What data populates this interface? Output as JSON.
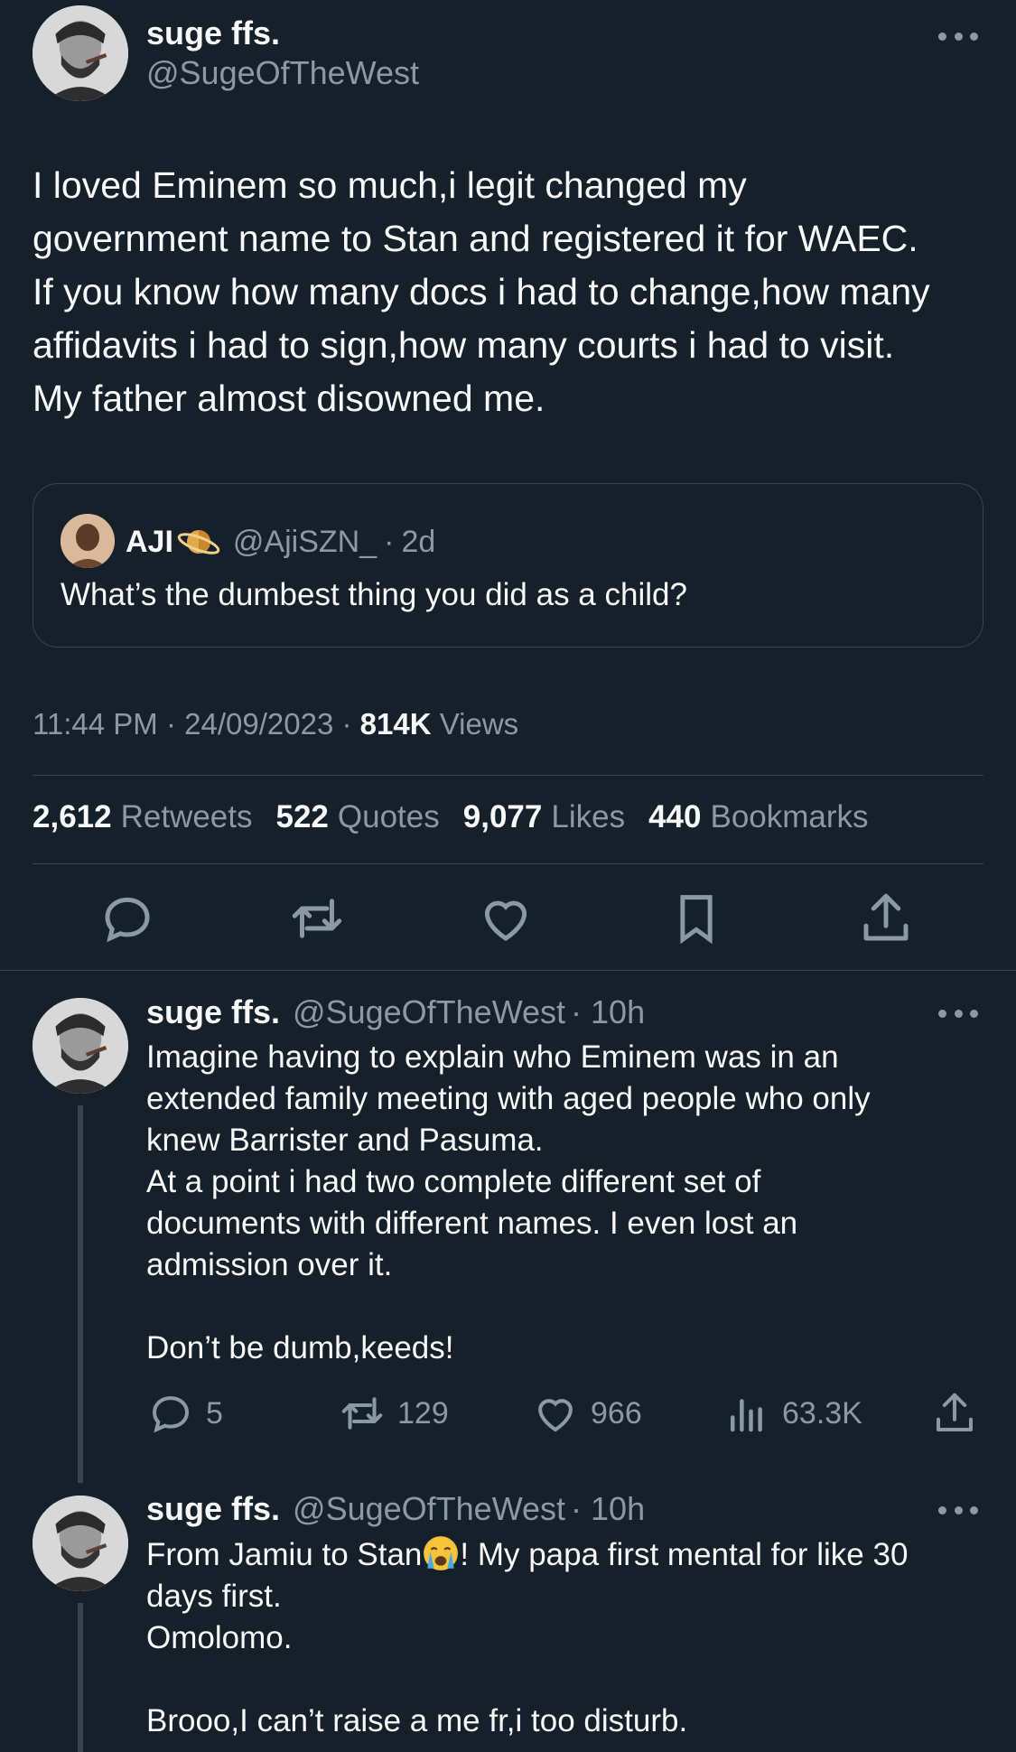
{
  "main_tweet": {
    "author_name": "suge ffs.",
    "author_handle": "@SugeOfTheWest",
    "text": "I loved Eminem so much,i legit changed my\ngovernment name to Stan and registered it for WAEC.\nIf you know how many docs i had to change,how many\naffidavits i had to sign,how many courts i had to visit.\nMy father almost disowned me.",
    "quoted": {
      "author_name": "AJI",
      "author_handle": "@AjiSZN_",
      "separator": "·",
      "time": "2d",
      "text": "What’s the dumbest thing you did as a child?"
    },
    "meta": {
      "time": "11:44 PM",
      "date": "24/09/2023",
      "views_count": "814K",
      "views_label": "Views"
    },
    "stats": [
      {
        "count": "2,612",
        "label": "Retweets"
      },
      {
        "count": "522",
        "label": "Quotes"
      },
      {
        "count": "9,077",
        "label": "Likes"
      },
      {
        "count": "440",
        "label": "Bookmarks"
      }
    ],
    "actions": [
      "reply-icon",
      "retweet-icon",
      "like-icon",
      "bookmark-icon",
      "share-icon"
    ]
  },
  "replies": [
    {
      "author_name": "suge ffs.",
      "author_handle": "@SugeOfTheWest",
      "time": "· 10h",
      "text": "Imagine having to explain who Eminem was in an\nextended family meeting with aged people who only\nknew Barrister and Pasuma.\nAt a point i had two complete different set of\ndocuments with different names. I even lost an\nadmission over it.\n\nDon’t be dumb,keeds!",
      "replies": "5",
      "retweets": "129",
      "likes": "966",
      "views": "63.3K"
    },
    {
      "author_name": "suge ffs.",
      "author_handle": "@SugeOfTheWest",
      "time": "· 10h",
      "text_before_emoji": "From Jamiu to Stan",
      "text_after_emoji": "! My papa first mental for like 30\ndays first.\nOmolomo.\n\nBrooo,I can’t raise a me fr,i too disturb.",
      "emoji": "crying-face-emoji"
    }
  ],
  "colors": {
    "background": "#15202b",
    "text": "#f7f9f9",
    "muted": "#8b98a5",
    "border": "#38444d"
  }
}
